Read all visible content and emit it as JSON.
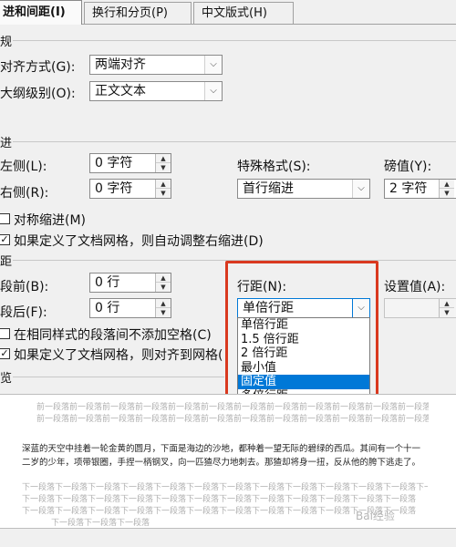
{
  "tabs": [
    {
      "label": "进和间距(I)",
      "active": true
    },
    {
      "label": "换行和分页(P)",
      "active": false
    },
    {
      "label": "中文版式(H)",
      "active": false
    }
  ],
  "general": {
    "section": "规",
    "align_label": "对齐方式(G):",
    "align_value": "两端对齐",
    "outline_label": "大纲级别(O):",
    "outline_value": "正文文本"
  },
  "indent": {
    "section": "进",
    "left_label": "左侧(L):",
    "left_value": "0 字符",
    "right_label": "右侧(R):",
    "right_value": "0 字符",
    "special_label": "特殊格式(S):",
    "special_value": "首行缩进",
    "by_label": "磅值(Y):",
    "by_value": "2 字符",
    "mirror_label": "对称缩进(M)",
    "mirror_checked": false,
    "auto_label": "如果定义了文档网格，则自动调整右缩进(D)",
    "auto_checked": true
  },
  "spacing": {
    "section": "距",
    "before_label": "段前(B):",
    "before_value": "0 行",
    "after_label": "段后(F):",
    "after_value": "0 行",
    "line_label": "行距(N):",
    "line_value": "单倍行距",
    "at_label": "设置值(A):",
    "no_space_label": "在相同样式的段落间不添加空格(C)",
    "no_space_checked": false,
    "snap_label": "如果定义了文档网格，则对齐到网格(",
    "snap_checked": true,
    "options": [
      "单倍行距",
      "1.5 倍行距",
      "2 倍行距",
      "最小值",
      "固定值",
      "多倍行距"
    ],
    "selected_option": "固定值"
  },
  "preview": {
    "section": "览",
    "prev_line1": "前一段落前一段落前一段落前一段落前一段落前一段落前一段落前一段落前一段落前一段落前一段落前一段落前一段落",
    "prev_line2": "前一段落前一段落前一段落前一段落前一段落前一段落前一段落前一段落前一段落前一段落前一段落前一段落",
    "main_text": "深蓝的天空中挂着一轮金黄的圆月，下面是海边的沙地，都种着一望无际的碧绿的西瓜。其间有一个十一二岁的少年，项带银圈，手捏一柄钢叉，向一匹猹尽力地刺去。那猹却将身一扭，反从他的胯下逃走了。",
    "next_line1": "下一段落下一段落下一段落下一段落下一段落下一段落下一段落下一段落下一段落下一段落下一段落下一段落下一段落",
    "next_line2": "下一段落下一段落下一段落下一段落下一段落下一段落下一段落下一段落下一段落下一段落下一段落下一段落",
    "next_line3": "下一段落下一段落下一段落下一段落下一段落下一段落下一段落下一段落下一段落下一段落下一段落下一段落",
    "next_line4": "下一段落下一段落下一段落",
    "watermark": "Bai经验"
  },
  "colors": {
    "highlight": "#d9391f",
    "selection": "#0078d7"
  }
}
